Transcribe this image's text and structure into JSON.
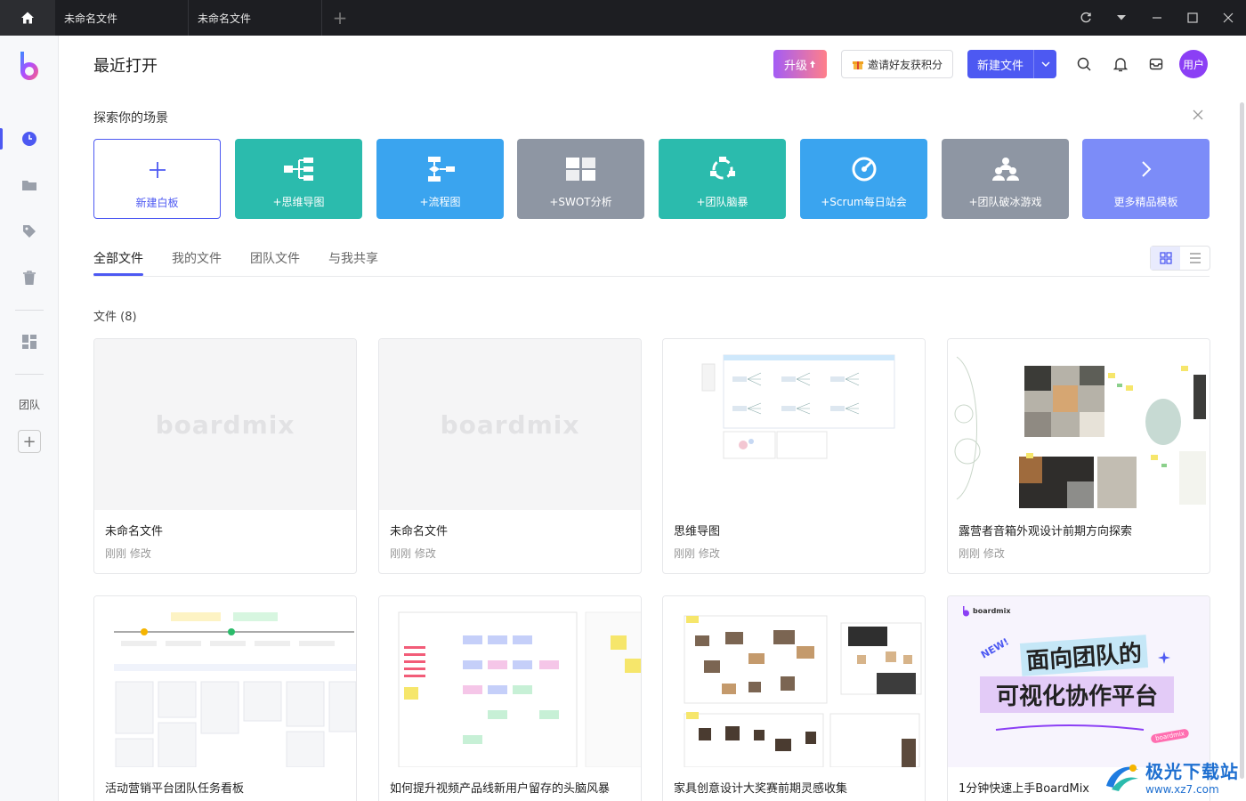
{
  "window": {
    "tabs": [
      {
        "label": "未命名文件"
      },
      {
        "label": "未命名文件"
      }
    ],
    "add_tab": "+"
  },
  "sidebar": {
    "team_label": "团队",
    "add_label": "+"
  },
  "header": {
    "title": "最近打开",
    "upgrade_label": "升级",
    "invite_label": "邀请好友获积分",
    "new_file_label": "新建文件",
    "avatar_label": "用户"
  },
  "scenes": {
    "title": "探索你的场景",
    "templates": [
      {
        "label": "新建白板",
        "color": "#ffffff"
      },
      {
        "label": "+思维导图",
        "color": "#2bbbad"
      },
      {
        "label": "+流程图",
        "color": "#3aa4ef"
      },
      {
        "label": "+SWOT分析",
        "color": "#8e96a3"
      },
      {
        "label": "+团队脑暴",
        "color": "#2bbbad"
      },
      {
        "label": "+Scrum每日站会",
        "color": "#3aa4ef"
      },
      {
        "label": "+团队破冰游戏",
        "color": "#8e96a3"
      },
      {
        "label": "更多精品模板",
        "color": "#7c8cf8"
      }
    ]
  },
  "file_tabs": [
    {
      "label": "全部文件"
    },
    {
      "label": "我的文件"
    },
    {
      "label": "团队文件"
    },
    {
      "label": "与我共享"
    }
  ],
  "files": {
    "count_label": "文件 (8)",
    "watermark": "boardmix",
    "items": [
      {
        "name": "未命名文件",
        "time": "刚刚 修改"
      },
      {
        "name": "未命名文件",
        "time": "刚刚 修改"
      },
      {
        "name": "思维导图",
        "time": "刚刚 修改"
      },
      {
        "name": "露营者音箱外观设计前期方向探索",
        "time": "刚刚 修改"
      },
      {
        "name": "活动营销平台团队任务看板",
        "time": ""
      },
      {
        "name": "如何提升视频产品线新用户留存的头脑风暴",
        "time": ""
      },
      {
        "name": "家具创意设计大奖赛前期灵感收集",
        "time": ""
      },
      {
        "name": "1分钟快速上手BoardMix",
        "time": ""
      }
    ],
    "promo": {
      "brand": "boardmix",
      "badge": "NEW!",
      "line1": "面向团队的",
      "line2": "可视化协作平台",
      "tag": "boardmix"
    }
  },
  "site_watermark": {
    "name": "极光下载站",
    "url": "www.xz7.com"
  },
  "colors": {
    "accent": "#4d59f2",
    "avatar": "#8b3ff5"
  }
}
